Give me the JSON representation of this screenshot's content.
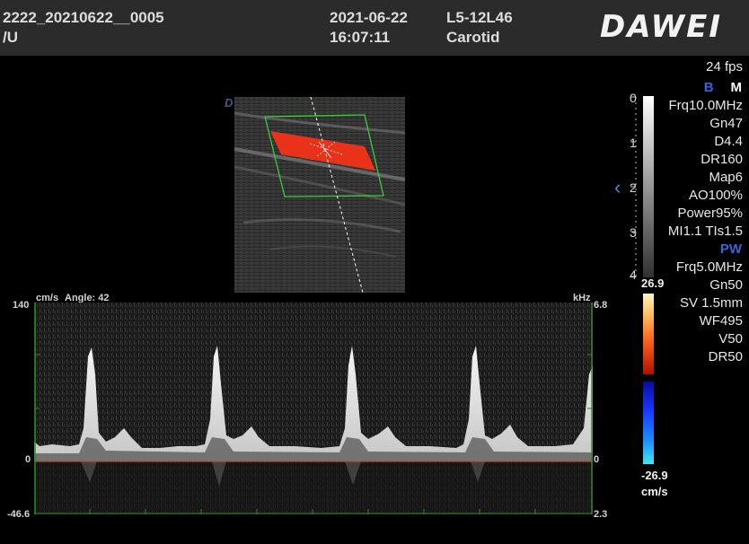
{
  "header": {
    "patient_id": "2222_20210622__0005",
    "unit": "/U",
    "date": "2021-06-22",
    "time": "16:07:11",
    "probe": "L5-12L46",
    "preset": "Carotid",
    "logo": "DAWEI"
  },
  "frame_rate": "24 fps",
  "modes": {
    "b": "B",
    "m": "M",
    "pw": "PW"
  },
  "b_params": [
    "Frq10.0MHz",
    "Gn47",
    "D4.4",
    "DR160",
    "Map6",
    "AO100%",
    "Power95%",
    "MI1.1 TIs1.5"
  ],
  "pw_params": [
    "Frq5.0MHz",
    "Gn50",
    "SV 1.5mm",
    "WF495",
    "V50",
    "DR50"
  ],
  "depth_scale": [
    "0",
    "1",
    "2",
    "3",
    "4"
  ],
  "color_bar": {
    "max": "26.9",
    "min": "-26.9",
    "unit": "cm/s"
  },
  "image_marker": "D",
  "spectrum": {
    "velocity_unit": "cm/s",
    "angle": "Angle: 42",
    "freq_unit": "kHz",
    "left_axis": {
      "top": "140",
      "baseline": "0",
      "bottom": "-46.6"
    },
    "right_axis": {
      "top": "6.8",
      "baseline": "0",
      "bottom": "2.3"
    }
  },
  "colors": {
    "header_bg": "#2b2b2b",
    "mode_blue": "#3a63d6",
    "flow_red": "#e8321a",
    "roi_green": "#3ccc3c",
    "axis_green": "#2a8a2a"
  },
  "icons": {
    "collapse_panel": "chevron-left-icon"
  }
}
